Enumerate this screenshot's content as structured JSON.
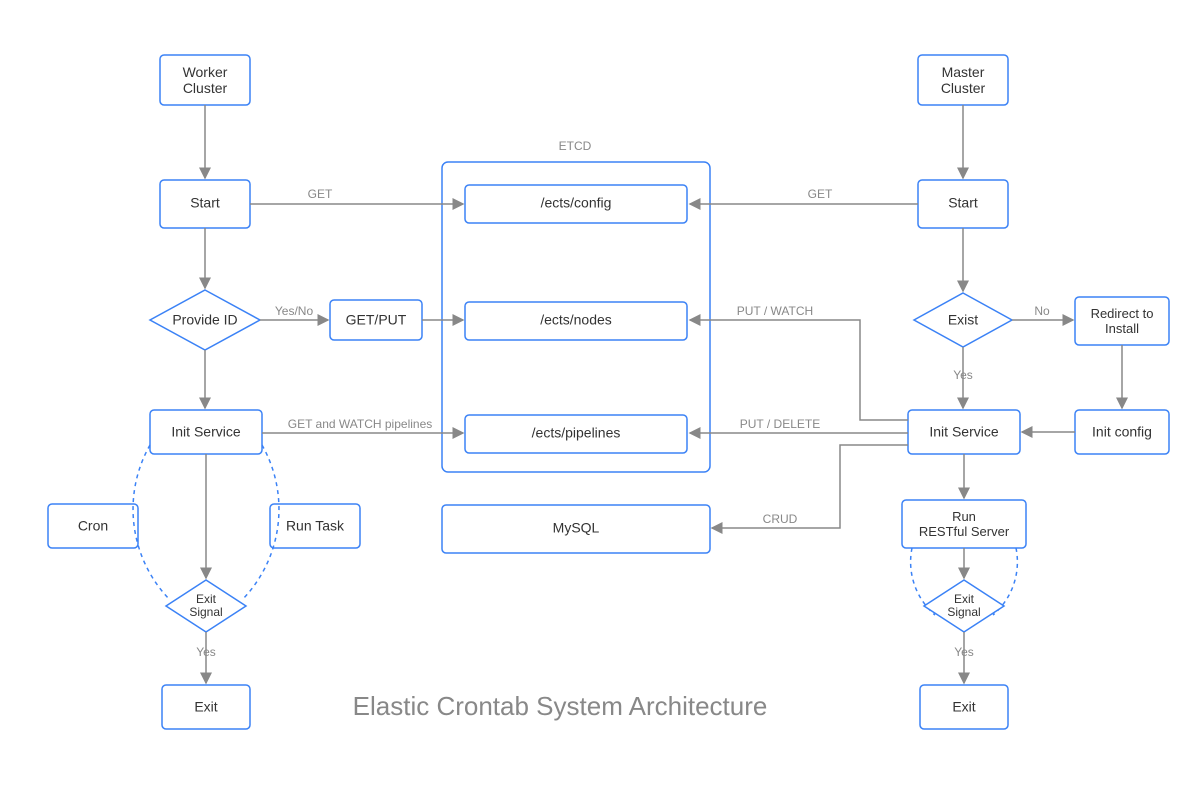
{
  "title": "Elastic Crontab System Architecture",
  "etcd_label": "ETCD",
  "nodes": {
    "worker_cluster": "Worker\nCluster",
    "master_cluster": "Master\nCluster",
    "start_w": "Start",
    "start_m": "Start",
    "provide_id": "Provide ID",
    "get_put": "GET/PUT",
    "init_service_w": "Init Service",
    "cron": "Cron",
    "run_task": "Run Task",
    "exit_signal_w": "Exit\nSignal",
    "exit_w": "Exit",
    "ects_config": "/ects/config",
    "ects_nodes": "/ects/nodes",
    "ects_pipelines": "/ects/pipelines",
    "mysql": "MySQL",
    "exist": "Exist",
    "redirect_install": "Redirect to\nInstall",
    "init_service_m": "Init Service",
    "init_config": "Init config",
    "run_restful": "Run\nRESTful Server",
    "exit_signal_m": "Exit\nSignal",
    "exit_m": "Exit"
  },
  "edges": {
    "get_w": "GET",
    "get_m": "GET",
    "yes_no": "Yes/No",
    "get_watch_pipelines": "GET and WATCH pipelines",
    "put_watch": "PUT / WATCH",
    "put_delete": "PUT / DELETE",
    "crud": "CRUD",
    "no": "No",
    "yes_m": "Yes",
    "yes_w": "Yes",
    "yes_exit_m": "Yes"
  }
}
